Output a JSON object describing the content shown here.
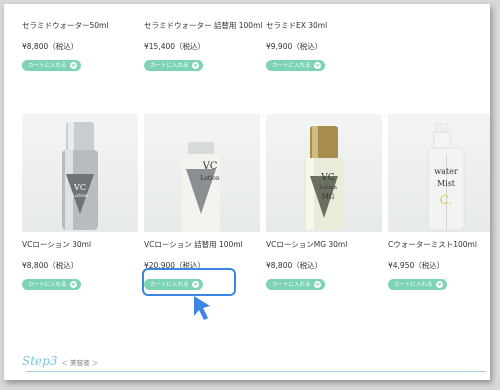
{
  "top_products": [
    {
      "name": "セラミドウォーター50ml",
      "price": "¥8,800（税込）"
    },
    {
      "name": "セラミドウォーター 詰替用 100ml",
      "price": "¥15,400（税込）"
    },
    {
      "name": "セラミドEX 30ml",
      "price": "¥9,900（税込）"
    }
  ],
  "bottom_products": [
    {
      "name": "VCローション 30ml",
      "price": "¥8,800（税込）",
      "bottle_text": "VC\nLotion"
    },
    {
      "name": "VCローション 詰替用 100ml",
      "price": "¥20,900（税込）",
      "bottle_text": "VC\nLotion"
    },
    {
      "name": "VCローションMG 30ml",
      "price": "¥8,800（税込）",
      "bottle_text": "VC\nLotion\nMG"
    },
    {
      "name": "Cウォーターミスト100ml",
      "price": "¥4,950（税込）",
      "bottle_text": "water\nMist\nC."
    }
  ],
  "cart_label": "カートに入れる",
  "step": {
    "label": "Step3",
    "sub": "＜ 美容液 ＞"
  },
  "colors": {
    "cart_button": "#7dd3b4",
    "highlight": "#3c85e6",
    "step_text": "#7cc6d8"
  },
  "icons": {
    "cart": "chevron-circle-icon",
    "pointer": "arrow-pointer-icon"
  }
}
